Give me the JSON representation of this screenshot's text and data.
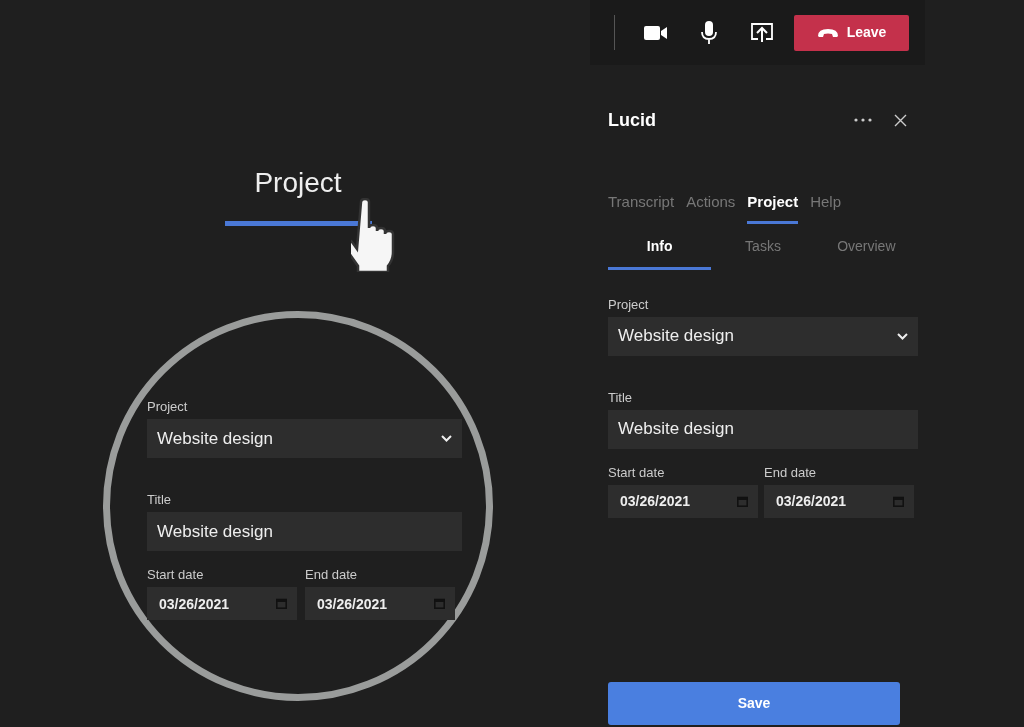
{
  "toolbar": {
    "buttons": [
      {
        "kind": "camera"
      },
      {
        "kind": "microphone"
      },
      {
        "kind": "share"
      }
    ],
    "leave_button": {
      "label": "Leave"
    }
  },
  "callout": {
    "tab": {
      "label": "Project",
      "selected": true
    },
    "form": {
      "project": {
        "label": "Project",
        "value": "Website design"
      },
      "title": {
        "label": "Title",
        "value": "Website design"
      },
      "start_date": {
        "label": "Start date",
        "value": "03/26/2021"
      },
      "end_date": {
        "label": "End date",
        "value": "03/26/2021"
      }
    }
  },
  "panel": {
    "title": "Lucid",
    "tabs": [
      {
        "label": "Transcript",
        "selected": false
      },
      {
        "label": "Actions",
        "selected": false
      },
      {
        "label": "Project",
        "selected": true
      },
      {
        "label": "Help",
        "selected": false
      }
    ],
    "subtabs": [
      {
        "label": "Info",
        "selected": true
      },
      {
        "label": "Tasks",
        "selected": false
      },
      {
        "label": "Overview",
        "selected": false
      }
    ],
    "form": {
      "project": {
        "label": "Project",
        "value": "Website design"
      },
      "title": {
        "label": "Title",
        "value": "Website design"
      },
      "start_date": {
        "label": "Start date",
        "value": "03/26/2021"
      },
      "end_date": {
        "label": "End date",
        "value": "03/26/2021"
      }
    },
    "save_button": {
      "label": "Save"
    }
  }
}
